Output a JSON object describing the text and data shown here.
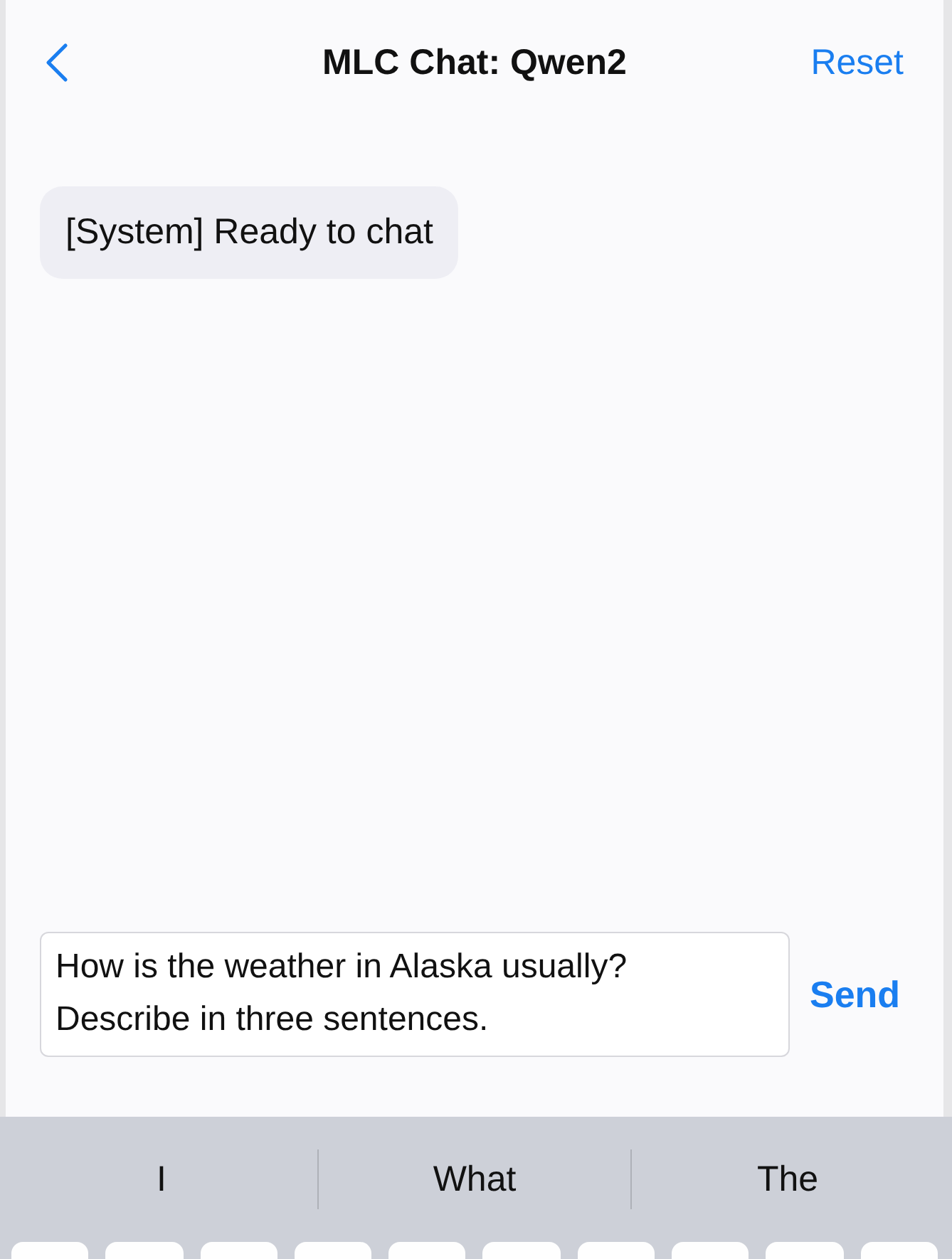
{
  "nav": {
    "title": "MLC Chat: Qwen2",
    "action": "Reset"
  },
  "messages": [
    {
      "text": "[System] Ready to chat"
    }
  ],
  "composer": {
    "value": "How is the weather in Alaska usually? Describe in three sentences.",
    "send": "Send"
  },
  "keyboard": {
    "suggestions": [
      "I",
      "What",
      "The"
    ]
  }
}
